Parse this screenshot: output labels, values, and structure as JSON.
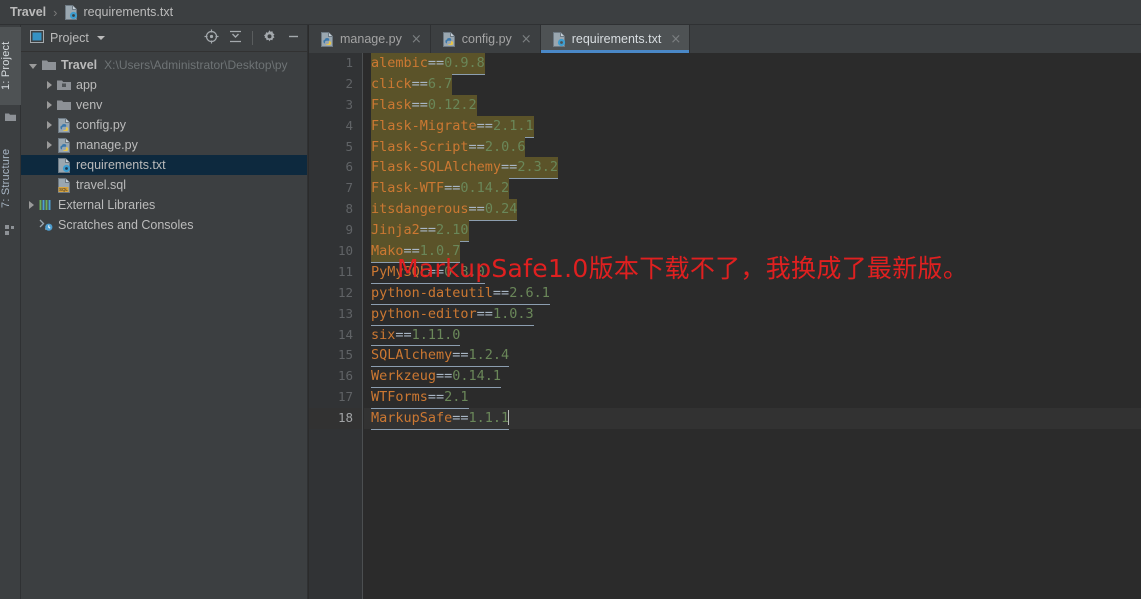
{
  "breadcrumb": {
    "project": "Travel",
    "separator": "›",
    "file": "requirements.txt",
    "file_icon": "txt-file-icon"
  },
  "tool_strip": {
    "tabs": [
      {
        "label": "1: Project",
        "icon": "folder-icon",
        "active": true
      },
      {
        "label": "7: Structure",
        "icon": "structure-icon",
        "active": false
      }
    ]
  },
  "project_panel": {
    "title": "Project",
    "title_icon": "project-view-icon",
    "dropdown_icon": "chevron-down-icon",
    "tools": [
      {
        "name": "locate-icon",
        "title": "Select Opened File"
      },
      {
        "name": "collapse-all-icon",
        "title": "Collapse All"
      },
      {
        "name": "gear-icon",
        "title": "Settings"
      },
      {
        "name": "minimize-icon",
        "title": "Hide"
      }
    ],
    "tree": [
      {
        "label": "Travel",
        "path": "X:\\Users\\Administrator\\Desktop\\py",
        "icon": "folder-icon",
        "arrow": "open",
        "indent": 0,
        "bold": true,
        "selected": false
      },
      {
        "label": "app",
        "icon": "module-folder-icon",
        "arrow": "closed",
        "indent": 1,
        "bold": false,
        "selected": false
      },
      {
        "label": "venv",
        "icon": "folder-icon",
        "arrow": "closed",
        "indent": 1,
        "bold": false,
        "selected": false
      },
      {
        "label": "config.py",
        "icon": "python-file-icon",
        "arrow": "closed",
        "indent": 1,
        "bold": false,
        "selected": false
      },
      {
        "label": "manage.py",
        "icon": "python-file-icon",
        "arrow": "closed",
        "indent": 1,
        "bold": false,
        "selected": false
      },
      {
        "label": "requirements.txt",
        "icon": "txt-file-icon",
        "arrow": "none",
        "indent": 1,
        "bold": false,
        "selected": true
      },
      {
        "label": "travel.sql",
        "icon": "sql-file-icon",
        "arrow": "none",
        "indent": 1,
        "bold": false,
        "selected": false
      },
      {
        "label": "External Libraries",
        "icon": "libraries-icon",
        "arrow": "closed",
        "indent": 0,
        "bold": false,
        "selected": false
      },
      {
        "label": "Scratches and Consoles",
        "icon": "scratches-icon",
        "arrow": "none",
        "indent": 0,
        "bold": false,
        "selected": false
      }
    ]
  },
  "editor": {
    "tabs": [
      {
        "label": "manage.py",
        "icon": "python-file-icon",
        "active": false,
        "close": "×"
      },
      {
        "label": "config.py",
        "icon": "python-file-icon",
        "active": false,
        "close": "×"
      },
      {
        "label": "requirements.txt",
        "icon": "txt-file-icon",
        "active": true,
        "close": "×"
      }
    ],
    "active_file": "requirements.txt",
    "cursor_line": 18,
    "lines": [
      {
        "n": 1,
        "pkg": "alembic",
        "op": "==",
        "ver": "0.9.8",
        "highlight": true,
        "underline": true
      },
      {
        "n": 2,
        "pkg": "click",
        "op": "==",
        "ver": "6.7",
        "highlight": true,
        "underline": true
      },
      {
        "n": 3,
        "pkg": "Flask",
        "op": "==",
        "ver": "0.12.2",
        "highlight": true,
        "underline": true
      },
      {
        "n": 4,
        "pkg": "Flask-Migrate",
        "op": "==",
        "ver": "2.1.1",
        "highlight": true,
        "underline": true
      },
      {
        "n": 5,
        "pkg": "Flask-Script",
        "op": "==",
        "ver": "2.0.6",
        "highlight": true,
        "underline": true
      },
      {
        "n": 6,
        "pkg": "Flask-SQLAlchemy",
        "op": "==",
        "ver": "2.3.2",
        "highlight": true,
        "underline": true
      },
      {
        "n": 7,
        "pkg": "Flask-WTF",
        "op": "==",
        "ver": "0.14.2",
        "highlight": true,
        "underline": true
      },
      {
        "n": 8,
        "pkg": "itsdangerous",
        "op": "==",
        "ver": "0.24",
        "highlight": true,
        "underline": true
      },
      {
        "n": 9,
        "pkg": "Jinja2",
        "op": "==",
        "ver": "2.10",
        "highlight": true,
        "underline": true
      },
      {
        "n": 10,
        "pkg": "Mako",
        "op": "==",
        "ver": "1.0.7",
        "highlight": true,
        "underline": true
      },
      {
        "n": 11,
        "pkg": "PyMySQL",
        "op": "==",
        "ver": "0.8.0",
        "highlight": false,
        "underline": true
      },
      {
        "n": 12,
        "pkg": "python-dateutil",
        "op": "==",
        "ver": "2.6.1",
        "highlight": false,
        "underline": true
      },
      {
        "n": 13,
        "pkg": "python-editor",
        "op": "==",
        "ver": "1.0.3",
        "highlight": false,
        "underline": true
      },
      {
        "n": 14,
        "pkg": "six",
        "op": "==",
        "ver": "1.11.0",
        "highlight": false,
        "underline": true
      },
      {
        "n": 15,
        "pkg": "SQLAlchemy",
        "op": "==",
        "ver": "1.2.4",
        "highlight": false,
        "underline": true
      },
      {
        "n": 16,
        "pkg": "Werkzeug",
        "op": "==",
        "ver": "0.14.1",
        "highlight": false,
        "underline": true
      },
      {
        "n": 17,
        "pkg": "WTForms",
        "op": "==",
        "ver": "2.1",
        "highlight": false,
        "underline": true
      },
      {
        "n": 18,
        "pkg": "MarkupSafe",
        "op": "==",
        "ver": "1.1.1",
        "highlight": false,
        "underline": true
      }
    ],
    "annotation": {
      "text": "MarkupSafe1.0版本下载不了，我换成了最新版。",
      "color": "#E02020"
    }
  },
  "colors": {
    "background": "#2B2B2B",
    "panel": "#3C3F41",
    "gutter": "#313335",
    "selection": "#0D293E",
    "tab_active": "#4E5254",
    "tab_underline": "#4A88C7",
    "package_name": "#CC7832",
    "version": "#6A8759",
    "highlight": "#5B5329",
    "annotation": "#E02020"
  }
}
